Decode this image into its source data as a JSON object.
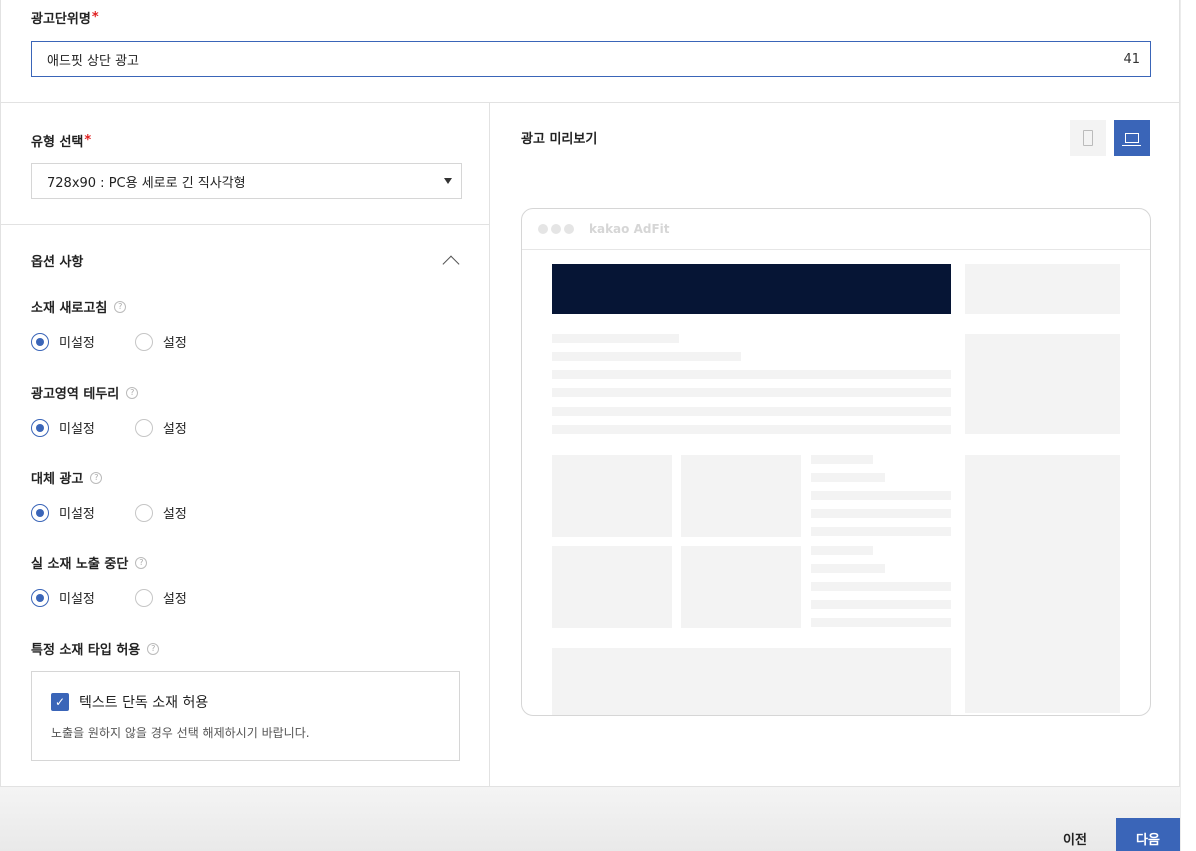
{
  "name_field": {
    "label": "광고단위명",
    "required_mark": "*",
    "value": "애드핏 상단 광고",
    "char_count": "41"
  },
  "type_select": {
    "label": "유형 선택",
    "required_mark": "*",
    "selected": "728x90 : PC용 세로로 긴 직사각형"
  },
  "options": {
    "title": "옵션 사항",
    "groups": [
      {
        "label": "소재 새로고침",
        "help": "?",
        "choices": [
          "미설정",
          "설정"
        ],
        "selected": "미설정"
      },
      {
        "label": "광고영역 테두리",
        "help": "?",
        "choices": [
          "미설정",
          "설정"
        ],
        "selected": "미설정"
      },
      {
        "label": "대체 광고",
        "help": "?",
        "choices": [
          "미설정",
          "설정"
        ],
        "selected": "미설정"
      },
      {
        "label": "실 소재 노출 중단",
        "help": "?",
        "choices": [
          "미설정",
          "설정"
        ],
        "selected": "미설정"
      }
    ],
    "special": {
      "label": "특정 소재 타입 허용",
      "help": "?",
      "checkbox_label": "텍스트 단독 소재 허용",
      "checked": true,
      "description": "노출을 원하지 않을 경우 선택 해제하시기 바랍니다."
    }
  },
  "preview": {
    "label": "광고 미리보기",
    "brand": "kakao AdFit",
    "banner_color": "#061535",
    "active_device": "pc"
  },
  "footer": {
    "prev_label": "이전",
    "next_label": "다음"
  },
  "colors": {
    "accent": "#3a65b8",
    "required": "#e02020"
  }
}
